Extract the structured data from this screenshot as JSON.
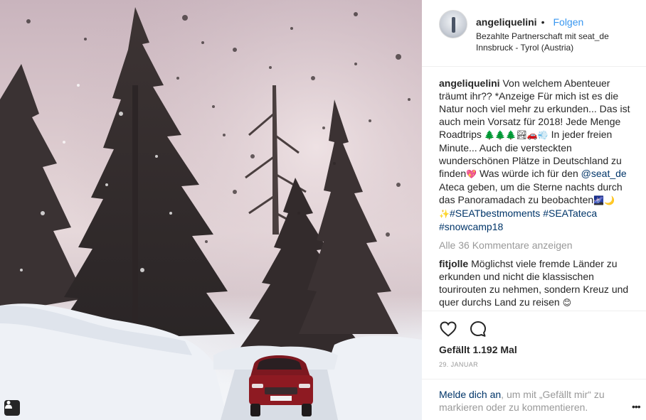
{
  "post": {
    "photo_alt": "",
    "header": {
      "username": "angeliquelini",
      "separator": "•",
      "follow_label": "Folgen",
      "partnership": "Bezahlte Partnerschaft mit seat_de",
      "location": "Innsbruck - Tyrol (Austria)"
    },
    "caption": {
      "username": "angeliquelini",
      "text_1": " Von welchem Abenteuer träumt ihr?? *Anzeige Für mich ist es die Natur noch viel mehr zu erkunden... Das ist auch mein Vorsatz für 2018! Jede Menge Roadtrips ",
      "emoji_1": "🌲🌲🌲🏞🚗💨",
      "text_2": " In jeder freien Minute... Auch die versteckten wunderschönen Plätze in Deutschland zu finden",
      "emoji_2": "💖",
      "text_3": " Was würde ich für den ",
      "mention": "@seat_de",
      "text_4": " Ateca geben, um die Sterne nachts durch das Panoramadach zu beobachten",
      "emoji_3": "🌌🌙",
      "emoji_4": "✨",
      "hashtag_1": "#SEATbestmoments",
      "hashtag_2": "#SEATateca",
      "hashtag_3": "#snowcamp18"
    },
    "view_all_comments": "Alle 36 Kommentare anzeigen",
    "comment": {
      "username": "fitjolle",
      "text": " Möglichst viele fremde Länder zu erkunden und nicht die klassischen tourirouten zu nehmen, sondern Kreuz und quer durchs Land zu reisen ",
      "emoji": "😊"
    },
    "likes": "Gefällt 1.192 Mal",
    "date": "29. JANUAR",
    "login_prompt": {
      "link": "Melde dich an",
      "text": ", um mit „Gefällt mir“ zu markieren oder zu kommentieren."
    },
    "more_label": "•••",
    "icons": {
      "like": "heart-icon",
      "comment": "speech-bubble-icon",
      "user_tag": "user-tag-icon",
      "more": "more-options-icon"
    },
    "colors": {
      "link_blue": "#3897f0",
      "dark_link": "#003569",
      "muted": "#999999",
      "text": "#262626",
      "car_red": "#8e1a22"
    }
  }
}
